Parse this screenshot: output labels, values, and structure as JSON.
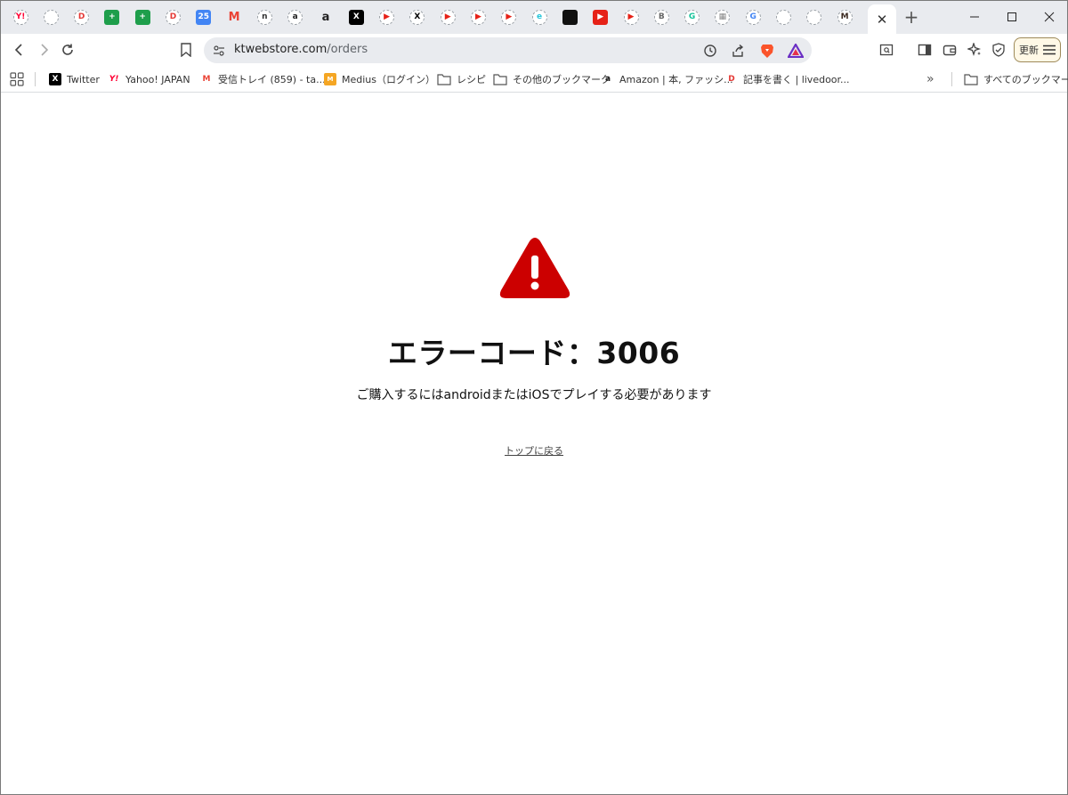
{
  "tabs": [
    {
      "icon": "yahoo-icon",
      "glyph": "Y!",
      "color": "#ff0033",
      "style": "ring"
    },
    {
      "icon": "green-circle-icon",
      "glyph": "",
      "color": "#8bc34a",
      "style": "ring"
    },
    {
      "icon": "d-logo-icon",
      "glyph": "D",
      "color": "#e53935",
      "style": "ring"
    },
    {
      "icon": "sheets-icon",
      "glyph": "+",
      "color": "#1e9e4b",
      "style": "sq"
    },
    {
      "icon": "sheets-icon",
      "glyph": "+",
      "color": "#1e9e4b",
      "style": "sq"
    },
    {
      "icon": "d-logo-icon",
      "glyph": "D",
      "color": "#e53935",
      "style": "ring"
    },
    {
      "icon": "calendar-icon",
      "glyph": "25",
      "color": "#4285f4",
      "style": "sq"
    },
    {
      "icon": "gmail-icon",
      "glyph": "M",
      "color": "#ea4335",
      "style": "plain"
    },
    {
      "icon": "note-icon",
      "glyph": "n",
      "color": "#333333",
      "style": "ring"
    },
    {
      "icon": "amazon-icon",
      "glyph": "a",
      "color": "#222222",
      "style": "ring"
    },
    {
      "icon": "amazon-icon",
      "glyph": "a",
      "color": "#222222",
      "style": "plain"
    },
    {
      "icon": "x-icon",
      "glyph": "X",
      "color": "#000000",
      "style": "sq"
    },
    {
      "icon": "youtube-icon",
      "glyph": "▶",
      "color": "#e62117",
      "style": "ring"
    },
    {
      "icon": "x-icon",
      "glyph": "X",
      "color": "#000000",
      "style": "ring"
    },
    {
      "icon": "youtube-icon",
      "glyph": "▶",
      "color": "#e62117",
      "style": "ring"
    },
    {
      "icon": "youtube-icon",
      "glyph": "▶",
      "color": "#e62117",
      "style": "ring"
    },
    {
      "icon": "youtube-icon",
      "glyph": "▶",
      "color": "#e62117",
      "style": "ring"
    },
    {
      "icon": "e-logo-icon",
      "glyph": "e",
      "color": "#26c6da",
      "style": "ring"
    },
    {
      "icon": "black-square-icon",
      "glyph": "",
      "color": "#111111",
      "style": "sq"
    },
    {
      "icon": "youtube-icon",
      "glyph": "▶",
      "color": "#e62117",
      "style": "sq"
    },
    {
      "icon": "youtube-icon",
      "glyph": "▶",
      "color": "#e62117",
      "style": "ring"
    },
    {
      "icon": "b-logo-icon",
      "glyph": "B",
      "color": "#666666",
      "style": "ring"
    },
    {
      "icon": "grammarly-icon",
      "glyph": "G",
      "color": "#15c39a",
      "style": "ring"
    },
    {
      "icon": "grid-icon",
      "glyph": "▦",
      "color": "#888888",
      "style": "ring"
    },
    {
      "icon": "google-icon",
      "glyph": "G",
      "color": "#4285f4",
      "style": "ring"
    },
    {
      "icon": "orange-circle-icon",
      "glyph": "",
      "color": "#f9a825",
      "style": "ring"
    },
    {
      "icon": "game-icon",
      "glyph": "",
      "color": "#c8a23a",
      "style": "ring"
    },
    {
      "icon": "m-logo-icon",
      "glyph": "M",
      "color": "#3b2a20",
      "style": "ring"
    }
  ],
  "active_tab": {
    "close_glyph": "✕"
  },
  "new_tab_glyph": "+",
  "window_controls": {
    "minimize": "—",
    "maximize": "☐",
    "close": "✕"
  },
  "omnibox": {
    "domain": "ktwebstore.com",
    "path": "/orders"
  },
  "update_button": {
    "label": "更新"
  },
  "bookmarks": [
    {
      "label": "Twitter",
      "icon": "x-icon"
    },
    {
      "label": "Yahoo! JAPAN",
      "icon": "yahoo-icon"
    },
    {
      "label": "受信トレイ (859) - ta...",
      "icon": "gmail-icon"
    },
    {
      "label": "Medius（ログイン）",
      "icon": "medius-icon"
    },
    {
      "label": "レシピ",
      "icon": "folder-icon"
    },
    {
      "label": "その他のブックマーク",
      "icon": "folder-icon"
    },
    {
      "label": "Amazon | 本, ファッシ...",
      "icon": "amazon-icon"
    },
    {
      "label": "記事を書く | livedoor...",
      "icon": "livedoor-icon"
    }
  ],
  "all_bookmarks": {
    "label": "すべてのブックマーク",
    "overflow_glyph": "»"
  },
  "page": {
    "title": "エラーコード：3006",
    "message": "ご購入するにはandroidまたはiOSでプレイする必要があります",
    "back_link": "トップに戻る"
  },
  "colors": {
    "warning_red": "#cc0000",
    "tabstrip_bg": "#e9ebef"
  }
}
